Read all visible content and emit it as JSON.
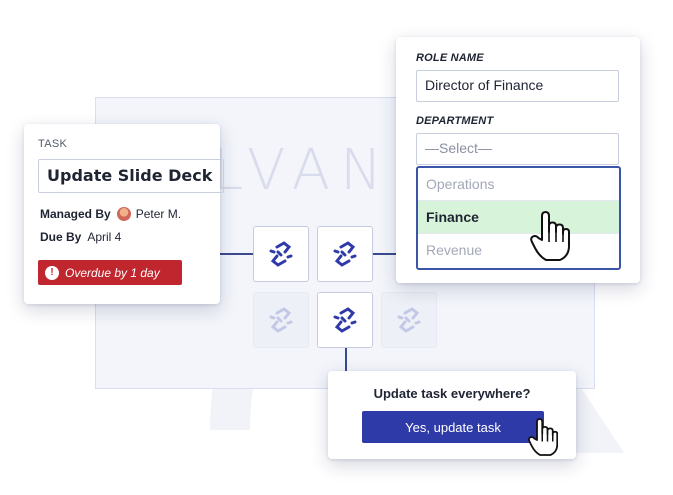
{
  "watermark": {
    "text": "LVAN"
  },
  "task_card": {
    "label": "TASK",
    "title": "Update Slide Deck",
    "managed_by_label": "Managed By",
    "managed_by_value": "Peter M.",
    "due_by_label": "Due By",
    "due_by_value": "April 4",
    "overdue_text": "Overdue by 1 day",
    "overdue_icon": "!"
  },
  "role_card": {
    "role_name_label": "ROLE NAME",
    "role_name_value": "Director of Finance",
    "department_label": "DEPARTMENT",
    "department_placeholder": "—Select—",
    "department_options": [
      {
        "label": "Operations"
      },
      {
        "label": "Finance",
        "selected": true
      },
      {
        "label": "Revenue"
      }
    ]
  },
  "confirm_card": {
    "question": "Update task everywhere?",
    "button_label": "Yes, update task"
  },
  "colors": {
    "accent": "#2f3aa9",
    "danger": "#c0262d",
    "selected_option": "#d7f3d9",
    "connector": "#3b4a8f"
  },
  "icons": {
    "tile_icon": "broken-link-icon",
    "cursor": "hand-pointer-icon"
  }
}
